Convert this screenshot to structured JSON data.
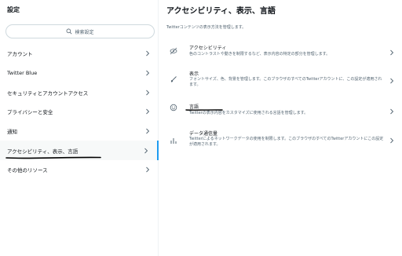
{
  "sidebar": {
    "title": "設定",
    "search_placeholder": "検索設定",
    "items": [
      {
        "label": "アカウント"
      },
      {
        "label": "Twitter Blue"
      },
      {
        "label": "セキュリティとアカウントアクセス"
      },
      {
        "label": "プライバシーと安全"
      },
      {
        "label": "通知"
      },
      {
        "label": "アクセシビリティ、表示、言語"
      },
      {
        "label": "その他のリソース"
      }
    ]
  },
  "main": {
    "title": "アクセシビリティ、表示、言語",
    "description": "Twitterコンテンツの表示方法を管理します。",
    "items": [
      {
        "icon": "accessibility-icon",
        "title": "アクセシビリティ",
        "description": "色のコントラストや動きを制限するなど、表示内容の特定の部分を管理します。"
      },
      {
        "icon": "brush-icon",
        "title": "表示",
        "description": "フォントサイズ、色、背景を管理します。このブラウザのすべてのTwitterアカウントに、この設定が適用されます。"
      },
      {
        "icon": "globe-icon",
        "title": "言語",
        "description": "Twitterの表示内容をカスタマイズに使用される言語を管理します。"
      },
      {
        "icon": "data-usage-icon",
        "title": "データ通信量",
        "description": "Twitterによるネットワークデータの使用を制限します。このブラウザのすべてのTwitterアカウントにこの設定が適用されます。"
      }
    ]
  },
  "colors": {
    "accent": "#1d9bf0",
    "text": "#0f1419",
    "secondary": "#536471",
    "annotation": "#000000"
  }
}
